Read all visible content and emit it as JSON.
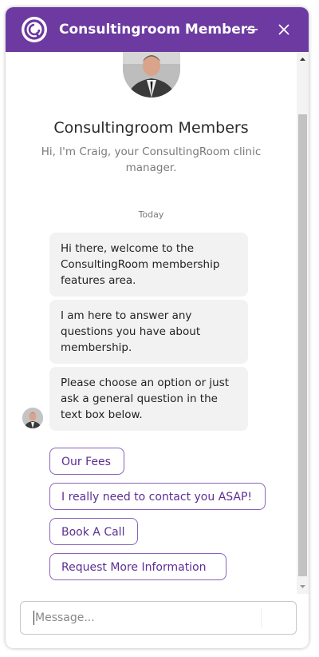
{
  "header": {
    "title": "Consultingroom Members",
    "icons": [
      "chat-logo-icon",
      "minimize-icon",
      "close-icon"
    ]
  },
  "profile": {
    "name": "Consultingroom Members",
    "description": "Hi, I'm Craig, your ConsultingRoom clinic manager."
  },
  "conversation": {
    "date": "Today",
    "messages": [
      "Hi there, welcome to the ConsultingRoom membership features area.",
      "I am here to answer any questions you have about membership.",
      "Please choose an option or just ask a general question in the text box below."
    ],
    "options": [
      "Our Fees",
      "I really need to contact you ASAP!",
      "Book A Call",
      "Request More Information"
    ]
  },
  "composer": {
    "placeholder": "Message..."
  },
  "colors": {
    "brand": "#6c3aa1",
    "option_border": "#8a62b8",
    "option_text": "#5d2e95",
    "bubble_bg": "#f2f2f2"
  }
}
